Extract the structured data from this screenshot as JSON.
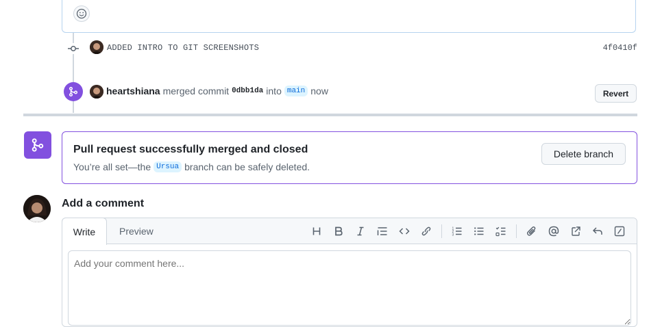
{
  "timeline": {
    "commit": {
      "message": "ADDED INTRO TO GIT SCREENSHOTS",
      "sha": "4f0410f"
    },
    "merge_event": {
      "user": "heartshiana",
      "verb": "merged commit",
      "commit_sha": "0dbb1da",
      "preposition": "into",
      "target_branch": "main",
      "time": "now",
      "revert_label": "Revert"
    }
  },
  "merge_status": {
    "title": "Pull request successfully merged and closed",
    "sub_before": "You’re all set—the",
    "branch": "Ursua",
    "sub_after": "branch can be safely deleted.",
    "delete_label": "Delete branch"
  },
  "comment": {
    "title": "Add a comment",
    "tabs": {
      "write": "Write",
      "preview": "Preview"
    },
    "placeholder": "Add your comment here...",
    "toolbar_icons": [
      "heading-icon",
      "bold-icon",
      "italic-icon",
      "quote-icon",
      "code-icon",
      "link-icon",
      "ordered-list-icon",
      "unordered-list-icon",
      "task-list-icon",
      "attach-icon",
      "mention-icon",
      "reference-icon",
      "reply-icon",
      "slash-command-icon"
    ]
  },
  "colors": {
    "merged_purple": "#8250df",
    "border": "#d0d7de",
    "branch_bg": "#ddf4ff",
    "branch_fg": "#0969da"
  }
}
